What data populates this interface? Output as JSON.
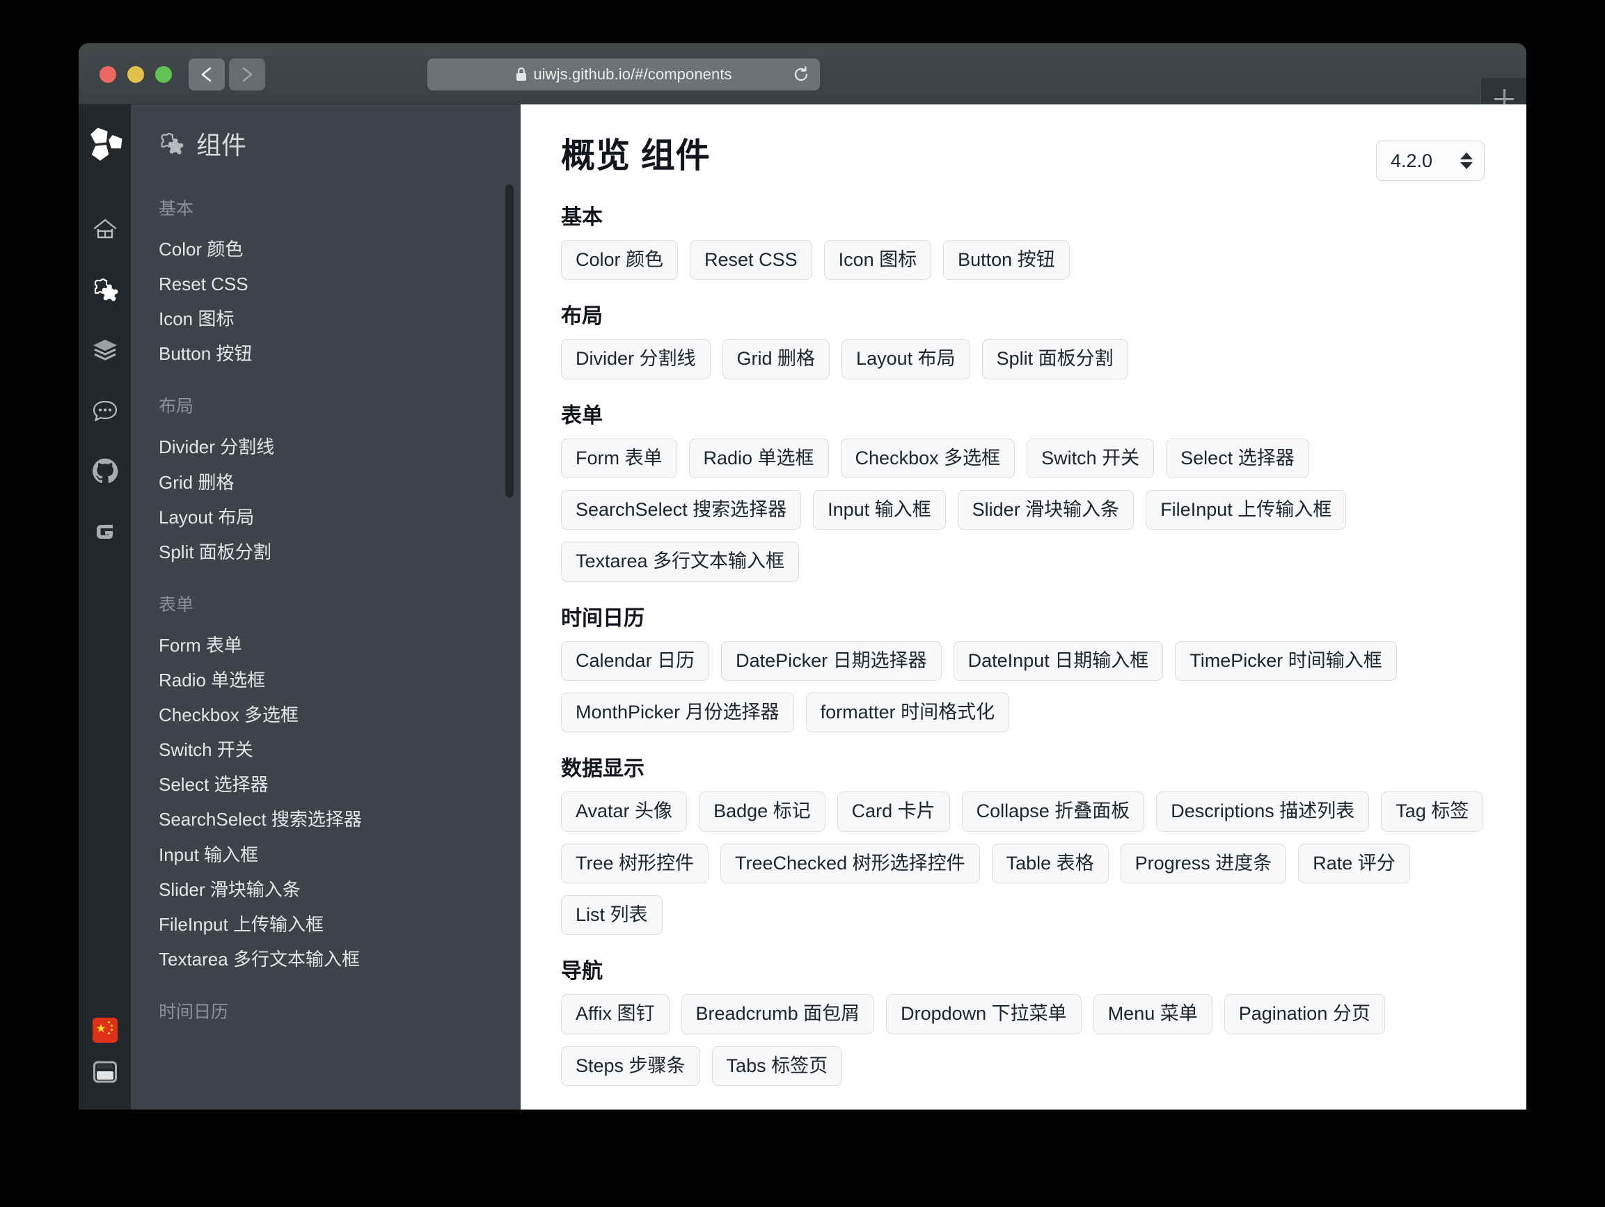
{
  "browser": {
    "url": "uiwjs.github.io/#/components",
    "lock_icon": "lock-icon",
    "back_icon": "chevron-left-icon",
    "forward_icon": "chevron-right-icon",
    "reload_icon": "reload-icon",
    "newtab_icon": "plus-icon",
    "traffic_lights": [
      "close",
      "minimize",
      "maximize"
    ]
  },
  "rail": {
    "logo": "uiw-logo",
    "items": [
      {
        "name": "home-icon"
      },
      {
        "name": "puzzle-icon"
      },
      {
        "name": "layers-icon"
      },
      {
        "name": "comment-icon"
      },
      {
        "name": "github-icon"
      },
      {
        "name": "gitee-icon"
      }
    ],
    "bottom": [
      {
        "name": "china-flag-icon"
      },
      {
        "name": "layout-toggle-icon"
      }
    ]
  },
  "sidebar": {
    "title": "组件",
    "title_icon": "puzzle-icon",
    "groups": [
      {
        "label": "基本",
        "items": [
          "Color 颜色",
          "Reset CSS",
          "Icon 图标",
          "Button 按钮"
        ]
      },
      {
        "label": "布局",
        "items": [
          "Divider 分割线",
          "Grid 删格",
          "Layout 布局",
          "Split 面板分割"
        ]
      },
      {
        "label": "表单",
        "items": [
          "Form 表单",
          "Radio 单选框",
          "Checkbox 多选框",
          "Switch 开关",
          "Select 选择器",
          "SearchSelect 搜索选择器",
          "Input 输入框",
          "Slider 滑块输入条",
          "FileInput 上传输入框",
          "Textarea 多行文本输入框"
        ]
      },
      {
        "label": "时间日历",
        "items": []
      }
    ]
  },
  "main": {
    "title": "概览 组件",
    "version": "4.2.0",
    "sections": [
      {
        "title": "基本",
        "chips": [
          "Color 颜色",
          "Reset CSS",
          "Icon 图标",
          "Button 按钮"
        ]
      },
      {
        "title": "布局",
        "chips": [
          "Divider 分割线",
          "Grid 删格",
          "Layout 布局",
          "Split 面板分割"
        ]
      },
      {
        "title": "表单",
        "chips": [
          "Form 表单",
          "Radio 单选框",
          "Checkbox 多选框",
          "Switch 开关",
          "Select 选择器",
          "SearchSelect 搜索选择器",
          "Input 输入框",
          "Slider 滑块输入条",
          "FileInput 上传输入框",
          "Textarea 多行文本输入框"
        ]
      },
      {
        "title": "时间日历",
        "chips": [
          "Calendar 日历",
          "DatePicker 日期选择器",
          "DateInput 日期输入框",
          "TimePicker 时间输入框",
          "MonthPicker 月份选择器",
          "formatter 时间格式化"
        ]
      },
      {
        "title": "数据显示",
        "chips": [
          "Avatar 头像",
          "Badge 标记",
          "Card 卡片",
          "Collapse 折叠面板",
          "Descriptions 描述列表",
          "Tag 标签",
          "Tree 树形控件",
          "TreeChecked 树形选择控件",
          "Table 表格",
          "Progress 进度条",
          "Rate 评分",
          "List 列表"
        ]
      },
      {
        "title": "导航",
        "chips": [
          "Affix 图钉",
          "Breadcrumb 面包屑",
          "Dropdown 下拉菜单",
          "Menu 菜单",
          "Pagination 分页",
          "Steps 步骤条",
          "Tabs 标签页"
        ]
      }
    ]
  },
  "colors": {
    "rail_bg": "#25282b",
    "sidebar_bg": "#3d4349",
    "chrome_bg": "#3f4447",
    "chip_bg": "#f7f8fa",
    "chip_border": "#dadee3",
    "flag_red": "#dd3218",
    "flag_yellow": "#ffde2e"
  }
}
